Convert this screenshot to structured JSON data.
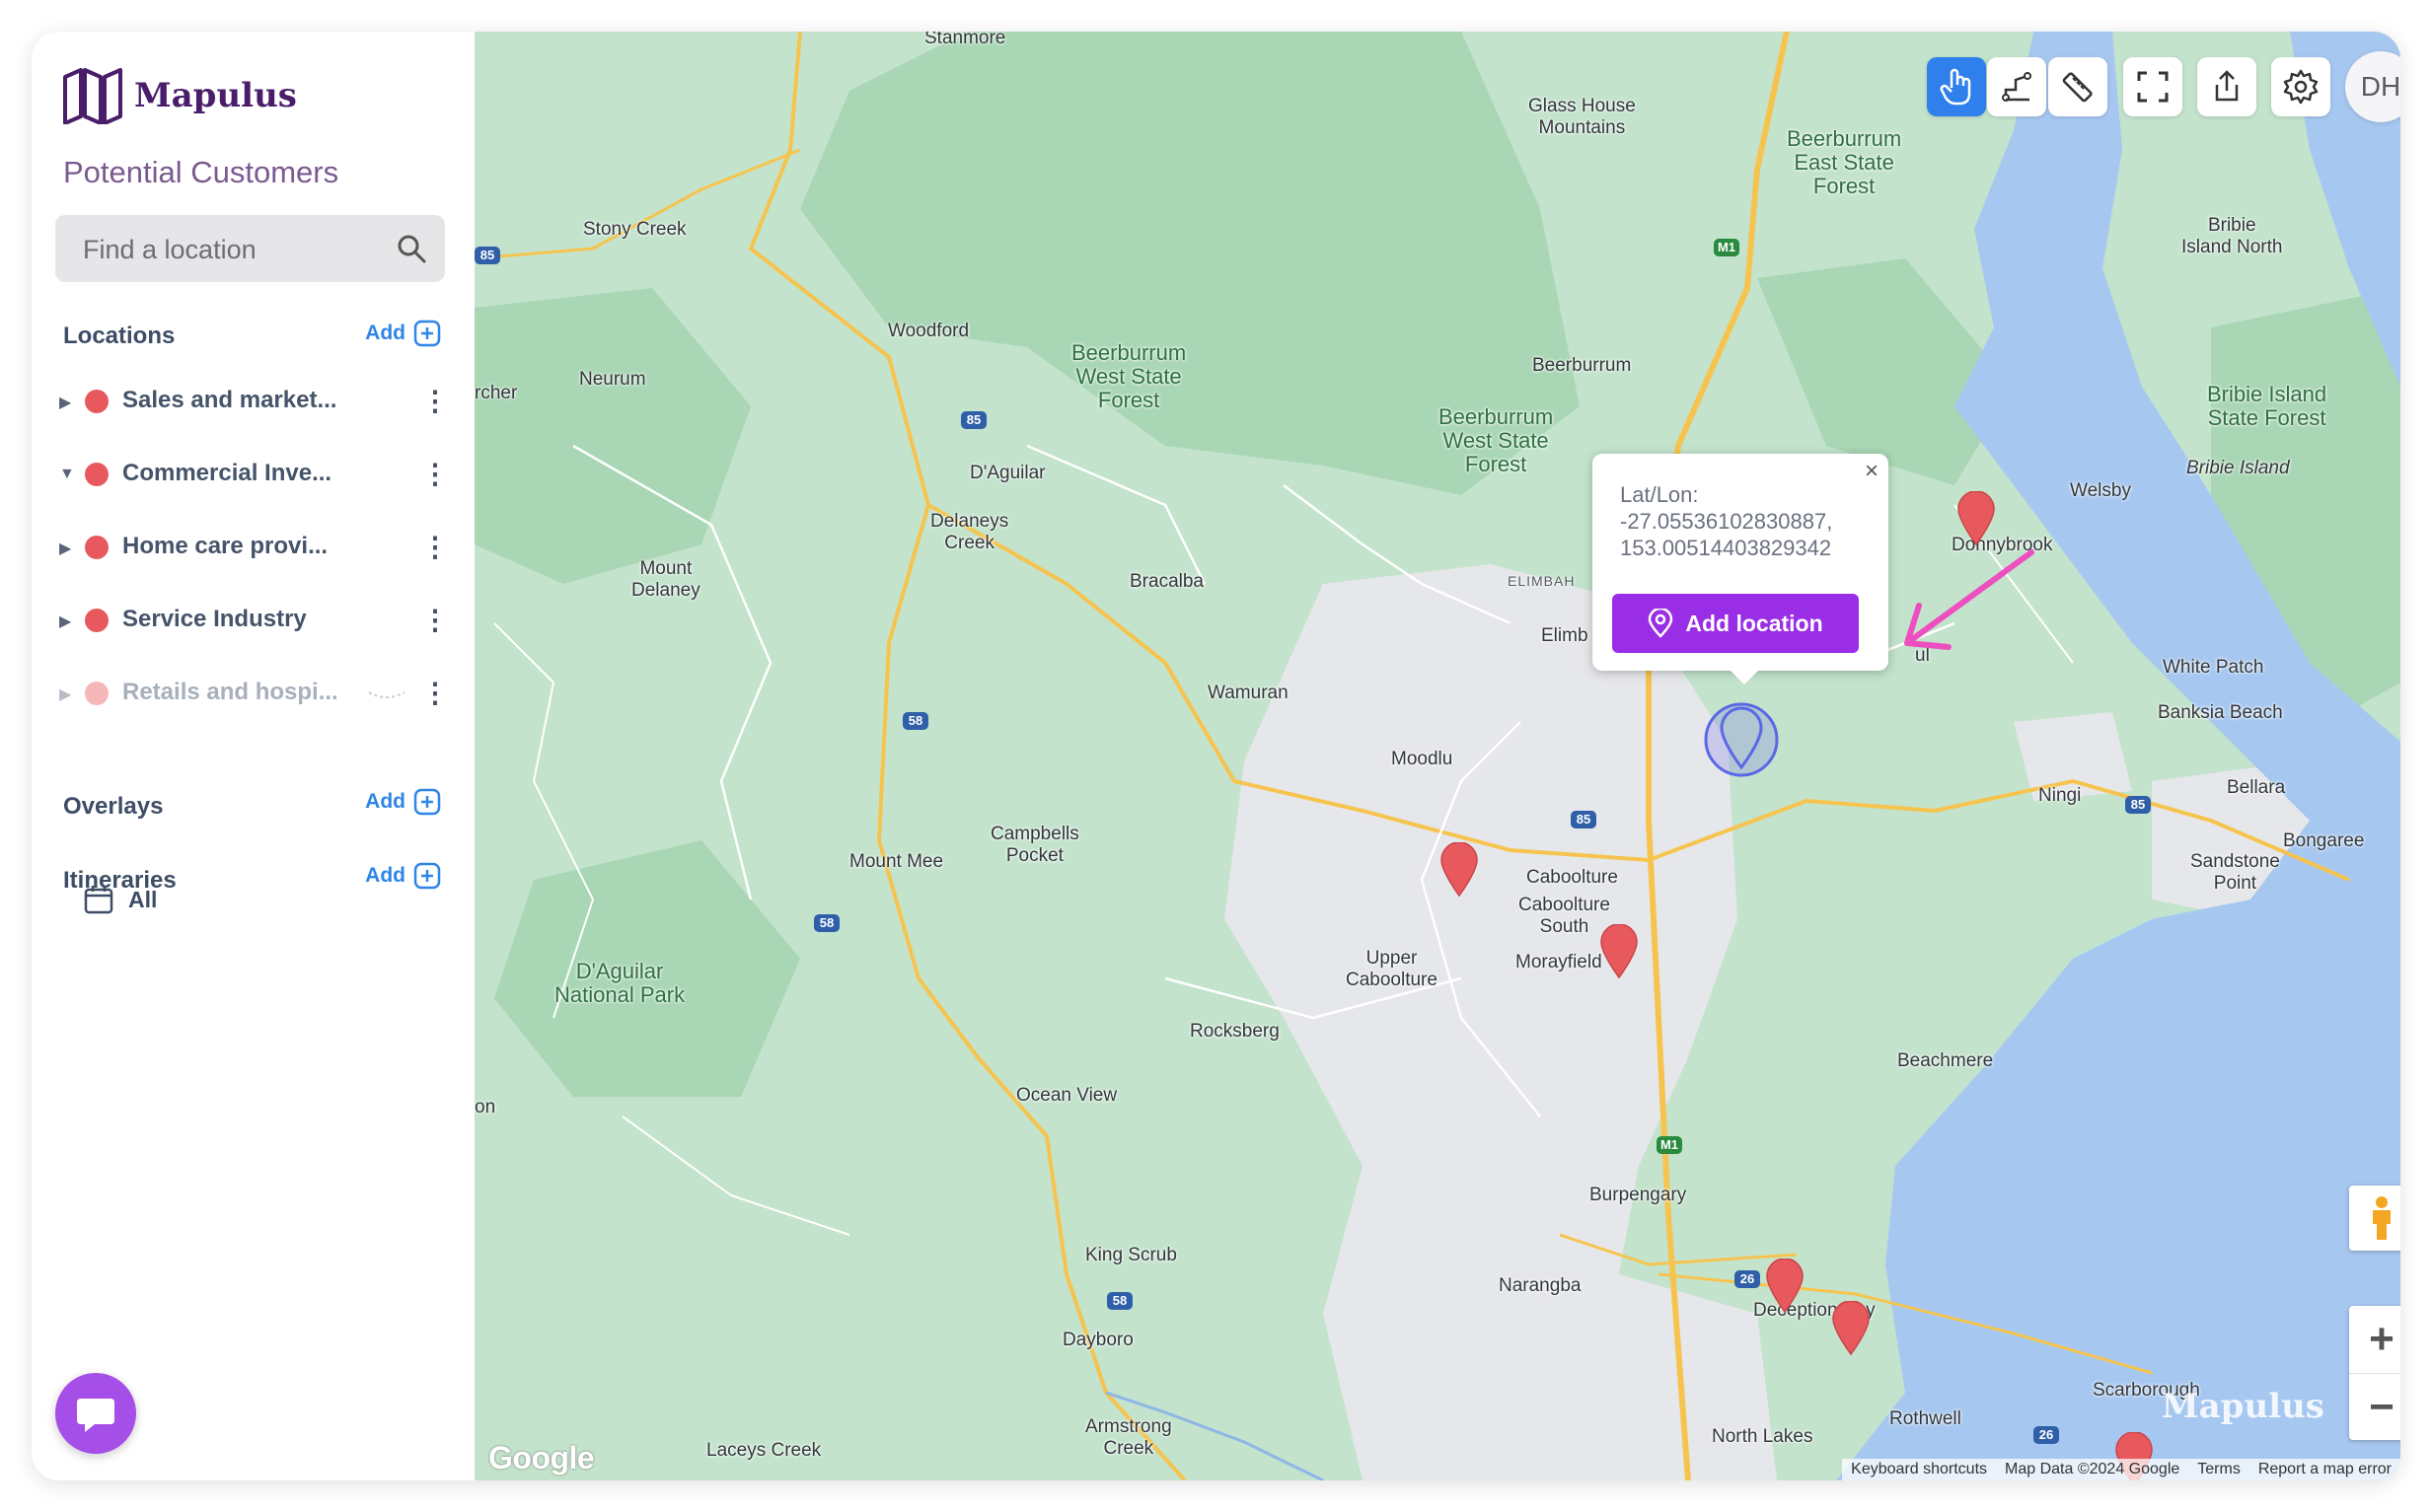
{
  "app": {
    "name": "Mapulus",
    "project_title": "Potential Customers"
  },
  "search": {
    "placeholder": "Find a location"
  },
  "sections": {
    "locations": {
      "title": "Locations",
      "add_label": "Add"
    },
    "overlays": {
      "title": "Overlays",
      "add_label": "Add"
    },
    "itineraries": {
      "title": "Itineraries",
      "add_label": "Add",
      "all_label": "All"
    }
  },
  "layers": [
    {
      "name": "Sales and market...",
      "color": "#e8595d",
      "expanded": false
    },
    {
      "name": "Commercial Inve...",
      "color": "#e8595d",
      "expanded": true
    },
    {
      "name": "Home care provi...",
      "color": "#e8595d",
      "expanded": false
    },
    {
      "name": "Service Industry",
      "color": "#e8595d",
      "expanded": false
    },
    {
      "name": "Retails and hospi...",
      "color": "#f5b7b8",
      "expanded": false,
      "loading": true
    }
  ],
  "toolbar": {
    "tools": [
      "hand-pointer-icon",
      "draw-area-icon",
      "ruler-icon",
      "fullscreen-icon",
      "share-icon",
      "gear-icon"
    ],
    "active_tool": "hand-pointer-icon",
    "avatar_initials": "DH"
  },
  "popup": {
    "coords_label": "Lat/Lon:",
    "lat": "-27.05536102830887,",
    "lon": "153.00514403829342",
    "button_label": "Add location",
    "close_label": "×"
  },
  "map_labels": {
    "stanmore": "Stanmore",
    "stony_creek": "Stony Creek",
    "glass_house": "Glass House",
    "glass_house_2": "Mountains",
    "beerburrum_east_1": "Beerburrum",
    "beerburrum_east_2": "East State",
    "beerburrum_east_3": "Forest",
    "bribie_north_1": "Bribie",
    "bribie_north_2": "Island North",
    "woodford": "Woodford",
    "neurum": "Neurum",
    "archer": "rcher",
    "beerburrum_west_1": "Beerburrum",
    "beerburrum_west_2": "West State",
    "beerburrum_west_3": "Forest",
    "beerburrum": "Beerburrum",
    "beerburrum_west2_1": "Beerburrum",
    "beerburrum_west2_2": "West State",
    "beerburrum_west2_3": "Forest",
    "bribie_sf_1": "Bribie Island",
    "bribie_sf_2": "State Forest",
    "bribie_island": "Bribie Island",
    "daguilar": "D'Aguilar",
    "welsby": "Welsby",
    "donnybrook": "Donnybrook",
    "delaneys_1": "Delaneys",
    "delaneys_2": "Creek",
    "mount_delaney_1": "Mount",
    "mount_delaney_2": "Delaney",
    "bracalba": "Bracalba",
    "elimbah_caps": "ELIMBAH",
    "elimbah": "Elimb",
    "white_patch": "White Patch",
    "banksia_beach": "Banksia Beach",
    "wamuran": "Wamuran",
    "moodlu": "Moodlu",
    "ningi": "Ningi",
    "bellara": "Bellara",
    "bongaree": "Bongaree",
    "campbells_1": "Campbells",
    "campbells_2": "Pocket",
    "mount_mee": "Mount Mee",
    "caboolture": "Caboolture",
    "caboolture_south_1": "Caboolture",
    "caboolture_south_2": "South",
    "sandstone_1": "Sandstone",
    "sandstone_2": "Point",
    "upper_cab_1": "Upper",
    "upper_cab_2": "Caboolture",
    "morayfield": "Morayfield",
    "daguilar_np_1": "D'Aguilar",
    "daguilar_np_2": "National Park",
    "rocksberg": "Rocksberg",
    "beachmere": "Beachmere",
    "ocean_view": "Ocean View",
    "on": "on",
    "burpengary": "Burpengary",
    "king_scrub": "King Scrub",
    "narangba": "Narangba",
    "deception_bay": "Deception Bay",
    "dayboro": "Dayboro",
    "scarborough": "Scarborough",
    "rothwell": "Rothwell",
    "armstrong_1": "Armstrong",
    "armstrong_2": "Creek",
    "laceys_creek": "Laceys Creek",
    "north_lakes": "North Lakes",
    "ul": "ul"
  },
  "road_shields": {
    "m1": "M1",
    "r85": "85",
    "r58": "58",
    "r26": "26"
  },
  "map_footer": {
    "google_logo": "Google",
    "keyboard": "Keyboard shortcuts",
    "map_data": "Map Data ©2024 Google",
    "terms": "Terms",
    "report": "Report a map error"
  },
  "watermark": "Mapulus",
  "colors": {
    "accent": "#9a2ee6",
    "active_tool": "#2f80ed",
    "pin": "#e8595d",
    "link": "#2f86e6"
  }
}
